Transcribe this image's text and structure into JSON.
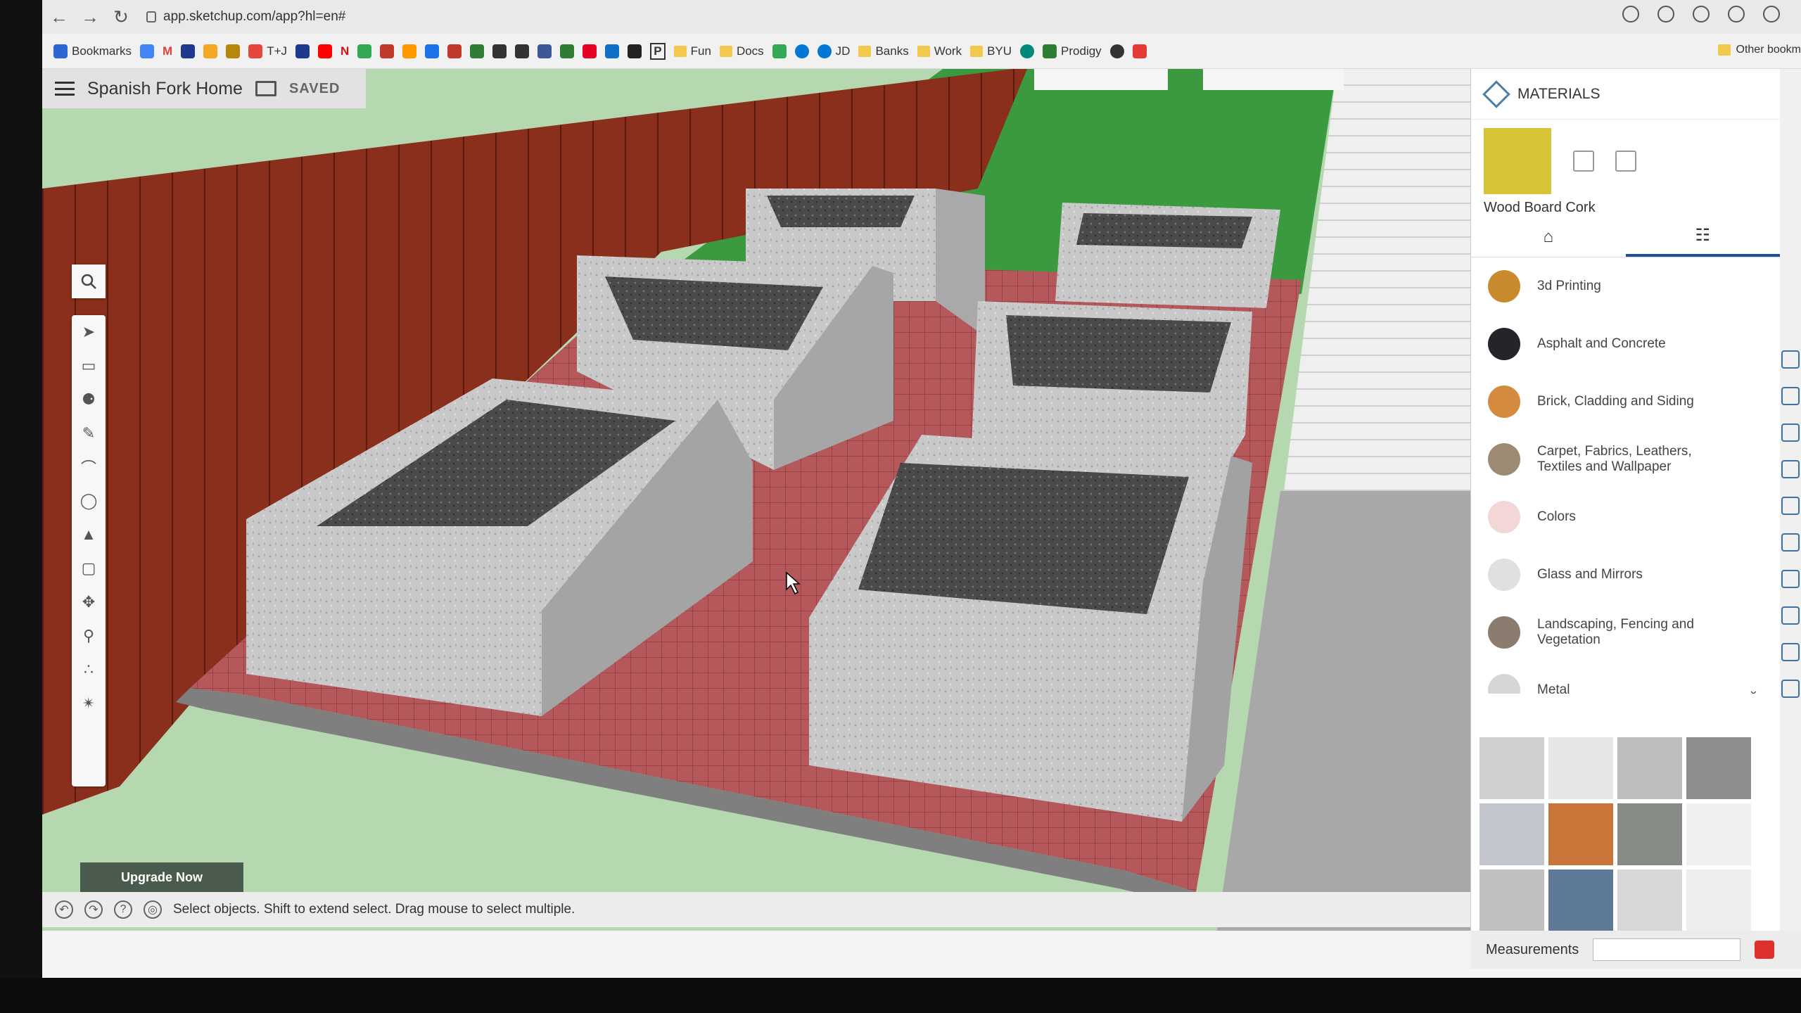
{
  "browser": {
    "url": "app.sketchup.com/app?hl=en#",
    "bookmarks": [
      {
        "label": "Bookmarks",
        "color": "#2a67d2"
      },
      {
        "label": "",
        "color": "#4285f4"
      },
      {
        "label": "M",
        "color": "#db4437"
      },
      {
        "label": "",
        "color": "#1d3a8f"
      },
      {
        "label": "",
        "color": "#f5a623"
      },
      {
        "label": "",
        "color": "#b8860b"
      },
      {
        "label": "T+J",
        "color": "#e8453c"
      },
      {
        "label": "",
        "color": "#ff0000"
      },
      {
        "label": "N",
        "color": "#e50914"
      },
      {
        "label": "",
        "color": "#34a853"
      },
      {
        "label": "",
        "color": "#c0392b"
      },
      {
        "label": "",
        "color": "#333333"
      },
      {
        "label": "",
        "color": "#1a73e8"
      },
      {
        "label": "",
        "color": "#c0392b"
      },
      {
        "label": "",
        "color": "#2e7d32"
      },
      {
        "label": "",
        "color": "#333333"
      },
      {
        "label": "",
        "color": "#333333"
      },
      {
        "label": "",
        "color": "#3b5998"
      },
      {
        "label": "",
        "color": "#2e7d32"
      },
      {
        "label": "",
        "color": "#e60023"
      },
      {
        "label": "",
        "color": "#0f6fc6"
      },
      {
        "label": "",
        "color": "#222222"
      },
      {
        "label": "P",
        "color": "#333333"
      }
    ],
    "folders": [
      "Fun",
      "Docs",
      "JD",
      "Banks",
      "Work",
      "BYU",
      "Prodigy"
    ],
    "other_bookmarks": "Other bookm"
  },
  "app": {
    "model_name": "Spanish Fork Home",
    "save_status": "SAVED",
    "upgrade_label": "Upgrade Now",
    "status_text": "Select objects. Shift to extend select. Drag mouse to select multiple.",
    "measurements_label": "Measurements"
  },
  "materials": {
    "title": "MATERIALS",
    "selected_name": "Wood Board Cork",
    "selected_color": "#d8c336",
    "categories": [
      {
        "label": "3d Printing",
        "color": "#c98a2e"
      },
      {
        "label": "Asphalt and Concrete",
        "color": "#24242a"
      },
      {
        "label": "Brick, Cladding and Siding",
        "color": "#d58b3f"
      },
      {
        "label": "Carpet, Fabrics, Leathers, Textiles and Wallpaper",
        "color": "#9c8a72"
      },
      {
        "label": "Colors",
        "color": "#f3d6d6"
      },
      {
        "label": "Glass and Mirrors",
        "color": "#e0e0e0"
      },
      {
        "label": "Landscaping, Fencing and Vegetation",
        "color": "#8a7c6e"
      },
      {
        "label": "Metal",
        "color": "#d6d6d6"
      }
    ],
    "thumbnails": [
      "#cfcfcf",
      "#e6e6e6",
      "#bdbdbd",
      "#8e8e8e",
      "#c2c6cc",
      "#c9753a",
      "#868b86",
      "#efefef",
      "#bfbfbf",
      "#5f7a99",
      "#d8d8d8",
      "#eeeeee"
    ]
  }
}
